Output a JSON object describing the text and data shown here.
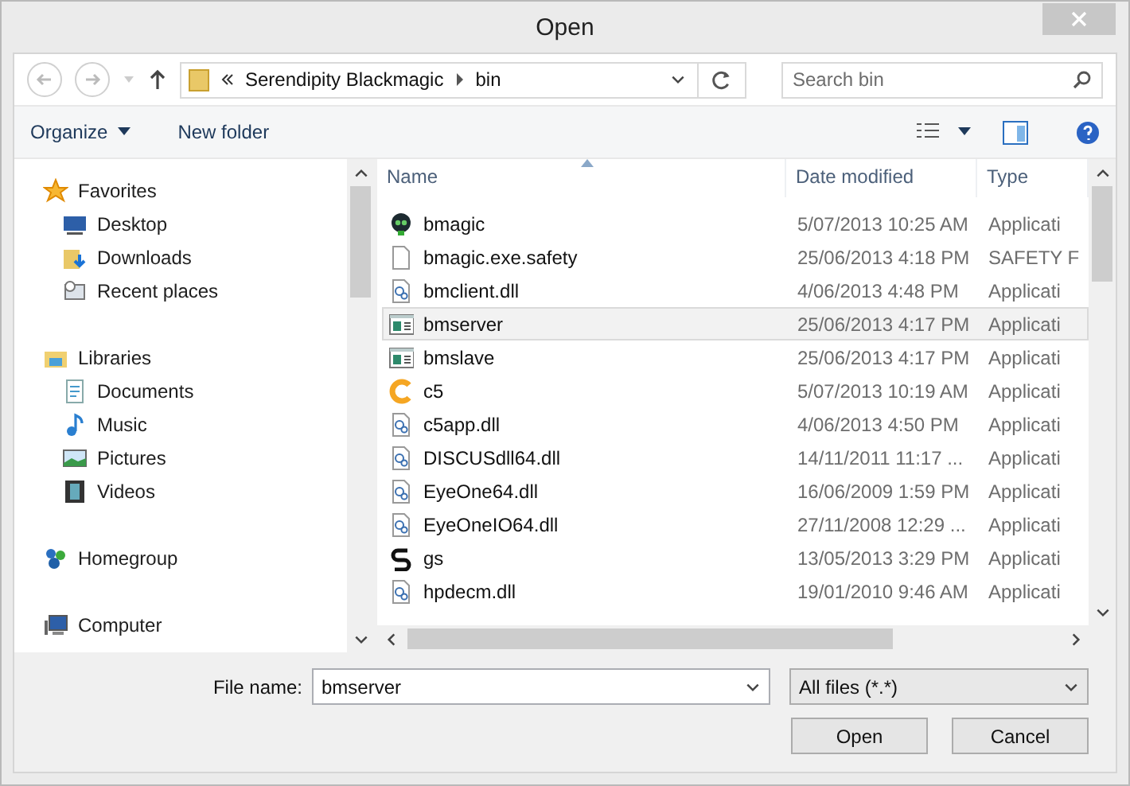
{
  "window": {
    "title": "Open"
  },
  "address": {
    "crumbs": [
      "Serendipity Blackmagic",
      "bin"
    ]
  },
  "search": {
    "placeholder": "Search bin"
  },
  "toolbar": {
    "organize": "Organize",
    "new_folder": "New folder"
  },
  "sidebar": {
    "groups": [
      {
        "label": "Favorites",
        "kind": "star",
        "children": [
          {
            "label": "Desktop",
            "kind": "desktop"
          },
          {
            "label": "Downloads",
            "kind": "downloads"
          },
          {
            "label": "Recent places",
            "kind": "recent"
          }
        ]
      },
      {
        "label": "Libraries",
        "kind": "libraries",
        "children": [
          {
            "label": "Documents",
            "kind": "documents"
          },
          {
            "label": "Music",
            "kind": "music"
          },
          {
            "label": "Pictures",
            "kind": "pictures"
          },
          {
            "label": "Videos",
            "kind": "videos"
          }
        ]
      },
      {
        "label": "Homegroup",
        "kind": "homegroup"
      },
      {
        "label": "Computer",
        "kind": "computer"
      }
    ]
  },
  "table": {
    "columns": [
      {
        "label": "Name",
        "sorted": true
      },
      {
        "label": "Date modified",
        "sorted": false
      },
      {
        "label": "Type",
        "sorted": false
      }
    ],
    "rows": [
      {
        "name": "bmagic",
        "date": "5/07/2013 10:25 AM",
        "type": "Applicati",
        "kind": "skull",
        "selected": false
      },
      {
        "name": "bmagic.exe.safety",
        "date": "25/06/2013 4:18 PM",
        "type": "SAFETY F",
        "kind": "blank",
        "selected": false
      },
      {
        "name": "bmclient.dll",
        "date": "4/06/2013 4:48 PM",
        "type": "Applicati",
        "kind": "dll",
        "selected": false
      },
      {
        "name": "bmserver",
        "date": "25/06/2013 4:17 PM",
        "type": "Applicati",
        "kind": "window",
        "selected": true
      },
      {
        "name": "bmslave",
        "date": "25/06/2013 4:17 PM",
        "type": "Applicati",
        "kind": "window",
        "selected": false
      },
      {
        "name": "c5",
        "date": "5/07/2013 10:19 AM",
        "type": "Applicati",
        "kind": "c5",
        "selected": false
      },
      {
        "name": "c5app.dll",
        "date": "4/06/2013 4:50 PM",
        "type": "Applicati",
        "kind": "dll",
        "selected": false
      },
      {
        "name": "DISCUSdll64.dll",
        "date": "14/11/2011 11:17 ...",
        "type": "Applicati",
        "kind": "dll",
        "selected": false
      },
      {
        "name": "EyeOne64.dll",
        "date": "16/06/2009 1:59 PM",
        "type": "Applicati",
        "kind": "dll",
        "selected": false
      },
      {
        "name": "EyeOneIO64.dll",
        "date": "27/11/2008 12:29 ...",
        "type": "Applicati",
        "kind": "dll",
        "selected": false
      },
      {
        "name": "gs",
        "date": "13/05/2013 3:29 PM",
        "type": "Applicati",
        "kind": "gs",
        "selected": false
      },
      {
        "name": "hpdecm.dll",
        "date": "19/01/2010 9:46 AM",
        "type": "Applicati",
        "kind": "dll",
        "selected": false
      }
    ]
  },
  "footer": {
    "file_name_label": "File name:",
    "file_name": "bmserver",
    "filter": "All files (*.*)",
    "buttons": [
      "Open",
      "Cancel"
    ]
  }
}
